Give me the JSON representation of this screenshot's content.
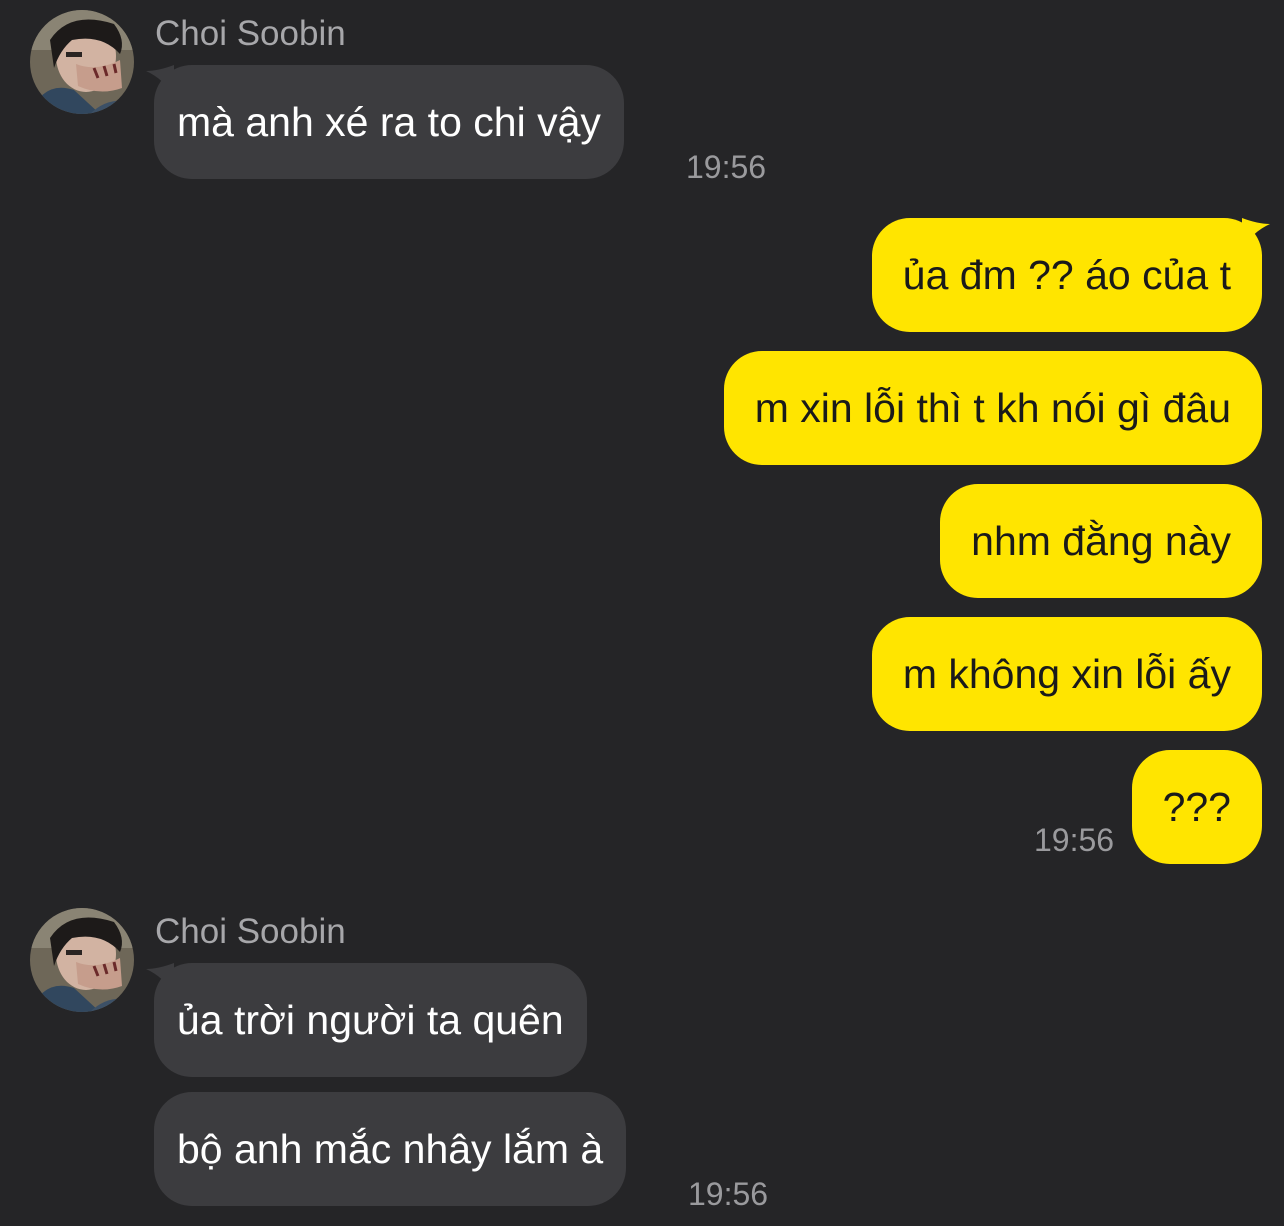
{
  "chat": {
    "background": "#252527",
    "incoming_bubble_color": "#3c3c3f",
    "outgoing_bubble_color": "#ffe500",
    "groups": [
      {
        "direction": "incoming",
        "sender": "Choi Soobin",
        "avatar_icon": "profile-photo",
        "messages": [
          "mà anh xé ra to chi vậy"
        ],
        "time": "19:56"
      },
      {
        "direction": "outgoing",
        "messages": [
          "ủa đm ?? áo của t",
          "m xin lỗi thì t kh nói gì đâu",
          "nhm đằng này",
          "m không xin lỗi ấy",
          "???"
        ],
        "time": "19:56"
      },
      {
        "direction": "incoming",
        "sender": "Choi Soobin",
        "avatar_icon": "profile-photo",
        "messages": [
          "ủa trời người ta quên",
          "bộ anh mắc nhây lắm à"
        ],
        "time": "19:56"
      }
    ]
  }
}
